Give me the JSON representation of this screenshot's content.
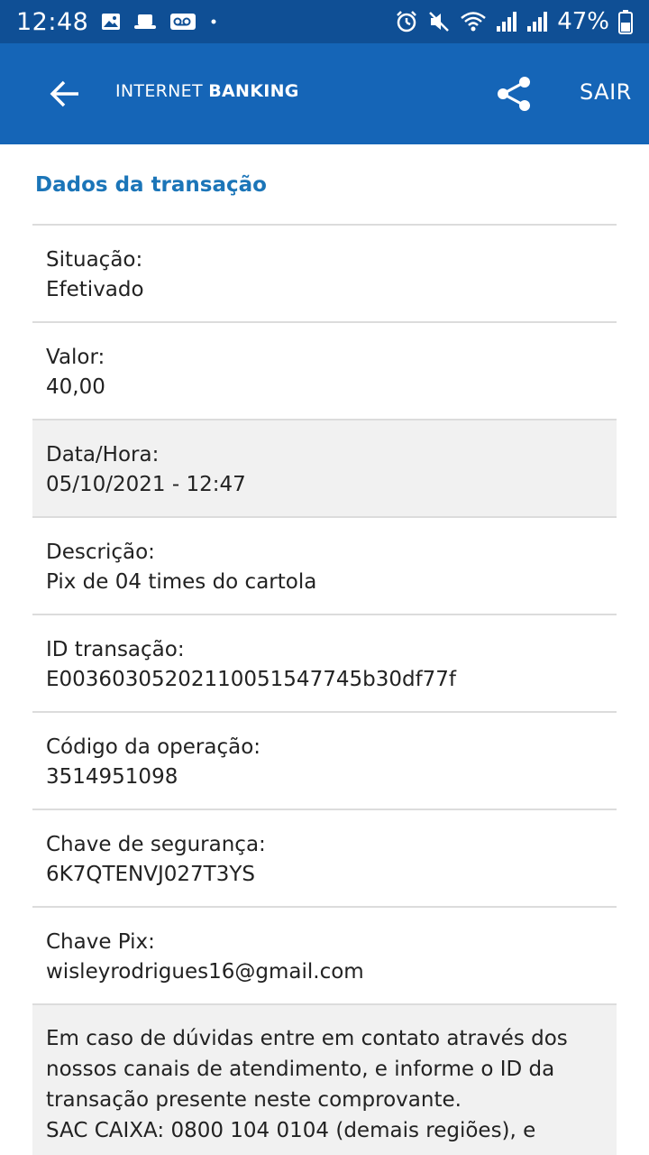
{
  "status_bar": {
    "time": "12:48",
    "battery": "47%"
  },
  "app_bar": {
    "brand_light": "INTERNET ",
    "brand_bold": "BANKING",
    "logout": "SAIR"
  },
  "section_title": "Dados da transação",
  "rows": [
    {
      "label": "Situação:",
      "value": "Efetivado"
    },
    {
      "label": "Valor:",
      "value": "40,00"
    },
    {
      "label": "Data/Hora:",
      "value": "05/10/2021 - 12:47"
    },
    {
      "label": "Descrição:",
      "value": "Pix de 04 times do cartola"
    },
    {
      "label": "ID transação:",
      "value": "E00360305202110051547745b30df77f"
    },
    {
      "label": "Código da operação:",
      "value": "3514951098"
    },
    {
      "label": "Chave de segurança:",
      "value": "6K7QTENVJ027T3YS"
    },
    {
      "label": "Chave Pix:",
      "value": "wisleyrodrigues16@gmail.com"
    }
  ],
  "notice": {
    "text": "Em caso de dúvidas entre em contato através dos nossos canais de atendimento, e informe o ID da transação presente neste comprovante.",
    "sac": "SAC CAIXA: 0800 104 0104 (demais regiões), e"
  }
}
